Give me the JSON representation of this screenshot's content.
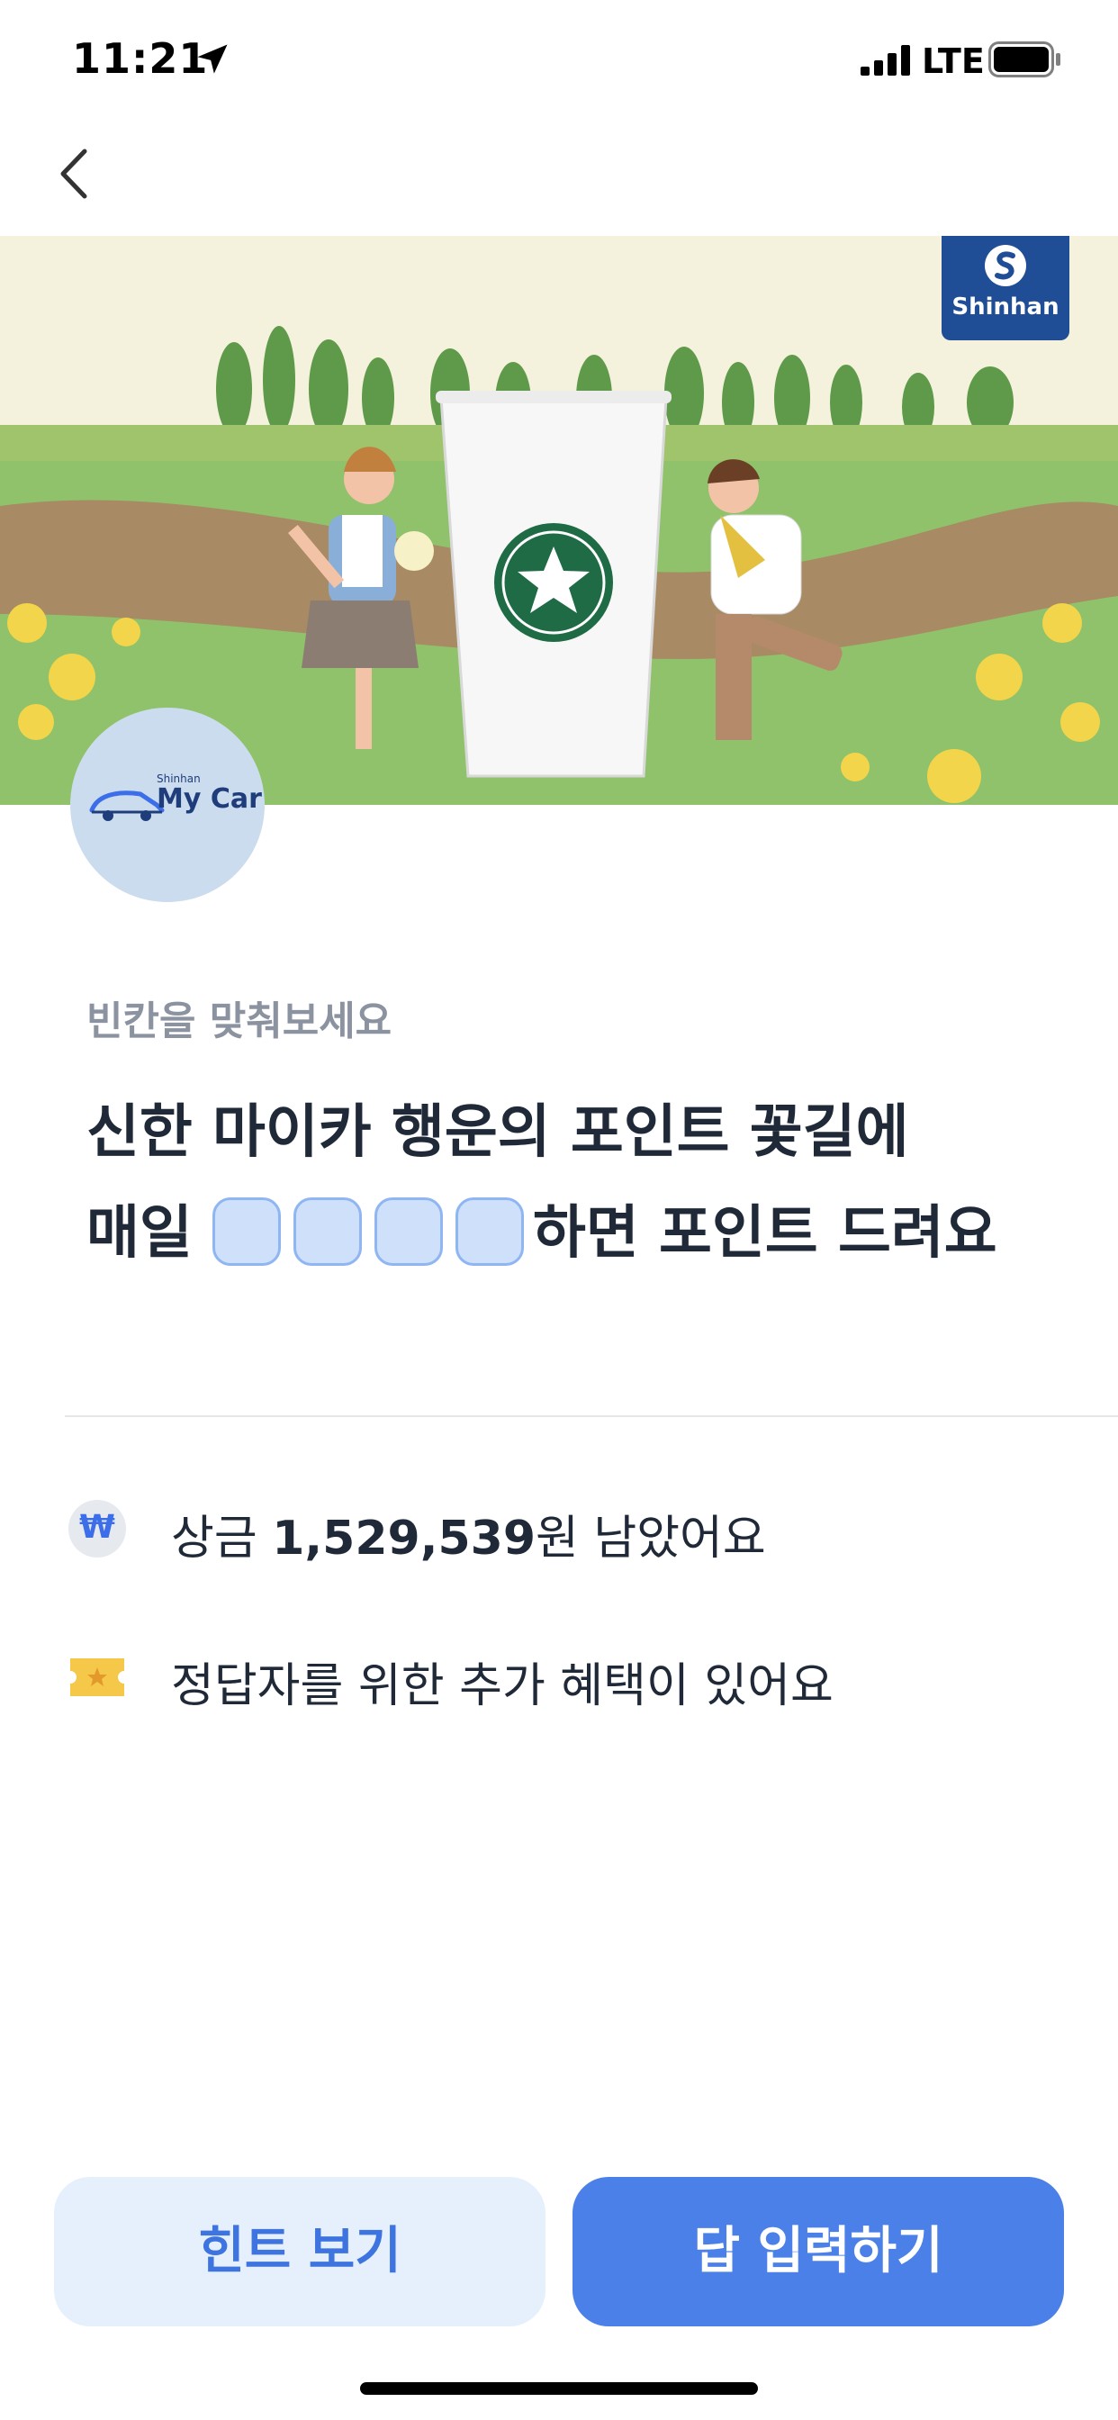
{
  "status_bar": {
    "time": "11:21",
    "network": "LTE"
  },
  "banner": {
    "brand": "Shinhan",
    "logo": {
      "small_text": "Shinhan",
      "main_text": "My Car"
    }
  },
  "quiz": {
    "subtitle": "빈칸을 맞춰보세요",
    "question_line1": "신한 마이카 행운의 포인트 꽃길에",
    "question_line2_prefix": "매일",
    "question_line2_suffix": "하면 포인트 드려요",
    "blank_count": 4
  },
  "info": {
    "prize_prefix": "상금 ",
    "prize_amount": "1,529,539",
    "prize_suffix": "원 남았어요",
    "bonus_text": "정답자를 위한 추가 혜택이 있어요",
    "won_symbol": "₩"
  },
  "buttons": {
    "hint": "힌트 보기",
    "answer": "답 입력하기"
  },
  "colors": {
    "primary": "#4a80e8",
    "primary_light": "#e6f0fd",
    "blank_fill": "#cfe0fb",
    "shinhan_blue": "#1f4e96"
  },
  "icons": {
    "location": "location-arrow-icon",
    "back": "chevron-left-icon",
    "won": "won-coin-icon",
    "ticket": "ticket-icon"
  }
}
